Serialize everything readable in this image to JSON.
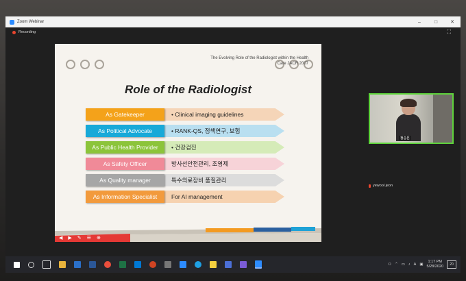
{
  "window": {
    "title": "Zoom Webinar",
    "recording_label": "Recording",
    "controls": [
      "–",
      "□",
      "✕"
    ]
  },
  "slide": {
    "citation_line1": "The Evolving Role of the Radiologist within the Health",
    "citation_line2": "Care JACR 2007",
    "title": "Role of the Radiologist",
    "rows": [
      {
        "role": "As Gatekeeper",
        "desc": "• Clinical imaging guidelines",
        "role_color": "#f4a21a",
        "arrow_color": "#f5d5b8"
      },
      {
        "role": "As Political Advocate",
        "desc": "• RANK-QS, 정책연구, 보험",
        "role_color": "#18a9d8",
        "arrow_color": "#b9dff0"
      },
      {
        "role": "As Public Health Provider",
        "desc": "• 건강검진",
        "role_color": "#8cc43a",
        "arrow_color": "#d5ebb8"
      },
      {
        "role": "As Safety Officer",
        "desc": "방사선안전관리, 조영제",
        "role_color": "#f08a98",
        "arrow_color": "#f7d3d8"
      },
      {
        "role": "As Quality manager",
        "desc": "특수의료장비 품질관리",
        "role_color": "#a6a6a6",
        "arrow_color": "#dcdcdc"
      },
      {
        "role": "As Information Specialist",
        "desc": "For AI management",
        "role_color": "#f29a3c",
        "arrow_color": "#f6d2b0"
      }
    ]
  },
  "video": {
    "participant_name": "정승은"
  },
  "attendee": {
    "name": "yewool jeon"
  },
  "taskbar": {
    "time": "1:17 PM",
    "date": "5/28/2020",
    "notifications": "20",
    "input_indicator": "A"
  }
}
